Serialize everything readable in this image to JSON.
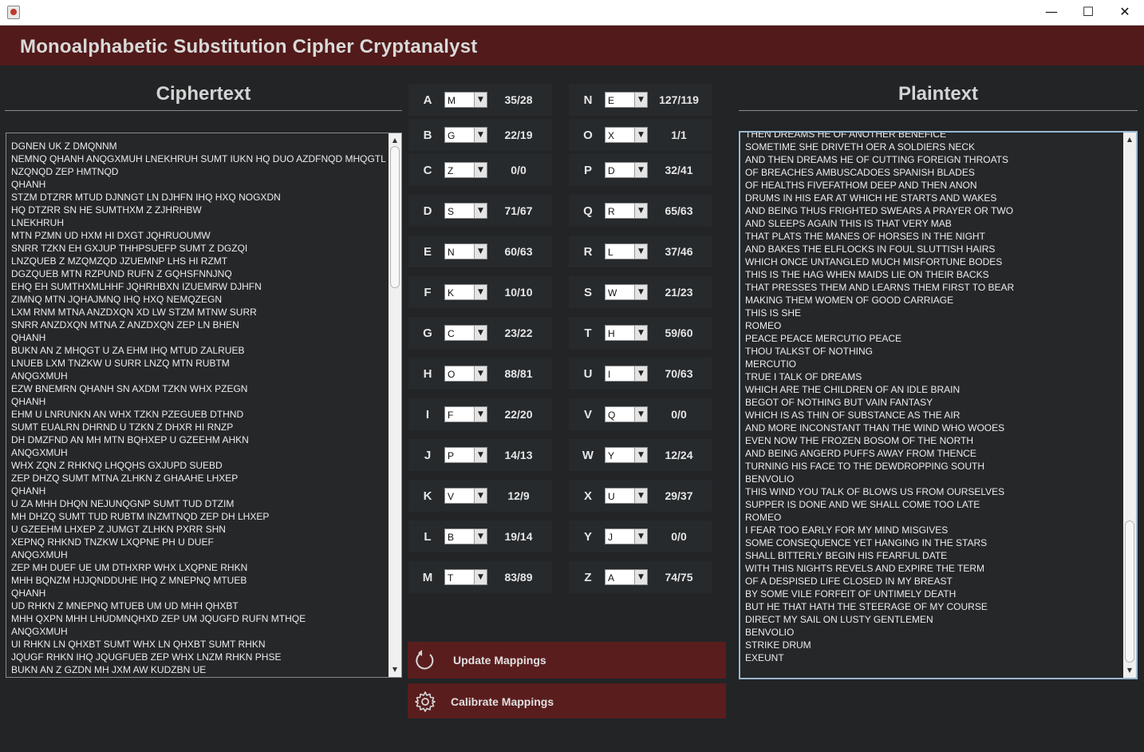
{
  "window": {
    "minimize_glyph": "—",
    "maximize_glyph": "☐",
    "close_glyph": "✕"
  },
  "header": {
    "title": "Monoalphabetic Substitution Cipher Cryptanalyst"
  },
  "ciphertext": {
    "title": "Ciphertext",
    "lines": [
      "DGNEN UK Z DMQNNM",
      "NEMNQ QHANH ANQGXMUH LNEKHRUH SUMT IUKN HQ DUO AZDFNQD MHQGTL",
      "NZQNQD ZEP HMTNQD",
      "QHANH",
      "STZM DTZRR MTUD DJNNGT LN DJHFN IHQ HXQ NOGXDN",
      "HQ DTZRR SN HE SUMTHXM Z ZJHRHBW",
      "LNEKHRUH",
      "MTN PZMN UD HXM HI DXGT JQHRUOUMW",
      "SNRR TZKN EH GXJUP THHPSUEFP SUMT Z DGZQI",
      "LNZQUEB Z MZQMZQD JZUEMNP LHS HI RZMT",
      "DGZQUEB MTN RZPUND RUFN Z GQHSFNNJNQ",
      "EHQ EH SUMTHXMLHHF JQHRHBXN IZUEMRW DJHFN",
      "ZIMNQ MTN JQHAJMNQ IHQ HXQ NEMQZEGN",
      "LXM RNM MTNA ANZDXQN XD LW STZM MTNW SURR",
      "SNRR ANZDXQN MTNA Z ANZDXQN ZEP LN BHEN",
      "QHANH",
      "BUKN AN Z MHQGT U ZA EHM IHQ MTUD ZALRUEB",
      "LNUEB LXM TNZKW U SURR LNZQ MTN RUBTM",
      "ANQGXMUH",
      "EZW BNEMRN QHANH SN AXDM TZKN WHX PZEGN",
      "QHANH",
      "EHM U LNRUNKN AN WHX TZKN PZEGUEB DTHND",
      "SUMT EUALRN DHRND U TZKN Z DHXR HI RNZP",
      "DH DMZFND AN MH MTN BQHXEP U GZEEHM AHKN",
      "ANQGXMUH",
      "WHX ZQN Z RHKNQ LHQQHS GXJUPD SUEBD",
      "ZEP DHZQ SUMT MTNA ZLHKN Z GHAAHE LHXEP",
      "QHANH",
      "U ZA MHH DHQN NEJUNQGNP SUMT TUD DTZIM",
      "MH DHZQ SUMT TUD RUBTM INZMTNQD ZEP DH LHXEP",
      "U GZEEHM LHXEP Z JUMGT ZLHKN PXRR SHN",
      "XEPNQ RHKND TNZKW LXQPNE PH U DUEF",
      "ANQGXMUH",
      "ZEP MH DUEF UE UM DTHXRP WHX LXQPNE RHKN",
      "MHH BQNZM HJJQNDDUHE IHQ Z MNEPNQ MTUEB",
      "QHANH",
      "UD RHKN Z MNEPNQ MTUEB UM UD MHH QHXBT",
      "MHH QXPN MHH LHUDMNQHXD ZEP UM JQUGFD RUFN MTHQE",
      "ANQGXMUH",
      "UI RHKN LN QHXBT SUMT WHX LN QHXBT SUMT RHKN",
      "JQUGF RHKN IHQ JQUGFUEB ZEP WHX LNZM RHKN PHSE",
      "BUKN AN Z GZDN MH JXM AW KUDZBN UE"
    ]
  },
  "plaintext": {
    "title": "Plaintext",
    "lines": [
      "THEN DREAMS HE OF ANOTHER BENEFICE",
      "SOMETIME SHE DRIVETH OER A SOLDIERS NECK",
      "AND THEN DREAMS HE OF CUTTING FOREIGN THROATS",
      "OF BREACHES AMBUSCADOES SPANISH BLADES",
      "OF HEALTHS FIVEFATHOM DEEP AND THEN ANON",
      "DRUMS IN HIS EAR AT WHICH HE STARTS AND WAKES",
      "AND BEING THUS FRIGHTED SWEARS A PRAYER OR TWO",
      "AND SLEEPS AGAIN THIS IS THAT VERY MAB",
      "THAT PLATS THE MANES OF HORSES IN THE NIGHT",
      "AND BAKES THE ELFLOCKS IN FOUL SLUTTISH HAIRS",
      "WHICH ONCE UNTANGLED MUCH MISFORTUNE BODES",
      "THIS IS THE HAG WHEN MAIDS LIE ON THEIR BACKS",
      "THAT PRESSES THEM AND LEARNS THEM FIRST TO BEAR",
      "MAKING THEM WOMEN OF GOOD CARRIAGE",
      "THIS IS SHE",
      "ROMEO",
      "PEACE PEACE MERCUTIO PEACE",
      "THOU TALKST OF NOTHING",
      "MERCUTIO",
      "TRUE I TALK OF DREAMS",
      "WHICH ARE THE CHILDREN OF AN IDLE BRAIN",
      "BEGOT OF NOTHING BUT VAIN FANTASY",
      "WHICH IS AS THIN OF SUBSTANCE AS THE AIR",
      "AND MORE INCONSTANT THAN THE WIND WHO WOOES",
      "EVEN NOW THE FROZEN BOSOM OF THE NORTH",
      "AND BEING ANGERD PUFFS AWAY FROM THENCE",
      "TURNING HIS FACE TO THE DEWDROPPING SOUTH",
      "BENVOLIO",
      "THIS WIND YOU TALK OF BLOWS US FROM OURSELVES",
      "SUPPER IS DONE AND WE SHALL COME TOO LATE",
      "ROMEO",
      "I FEAR TOO EARLY FOR MY MIND MISGIVES",
      "SOME CONSEQUENCE YET HANGING IN THE STARS",
      "SHALL BITTERLY BEGIN HIS FEARFUL DATE",
      "WITH THIS NIGHTS REVELS AND EXPIRE THE TERM",
      "OF A DESPISED LIFE CLOSED IN MY BREAST",
      "BY SOME VILE FORFEIT OF UNTIMELY DEATH",
      "BUT HE THAT HATH THE STEERAGE OF MY COURSE",
      "DIRECT MY SAIL ON LUSTY GENTLEMEN",
      "BENVOLIO",
      "STRIKE DRUM",
      "EXEUNT"
    ]
  },
  "mappings": {
    "left": [
      {
        "letter": "A",
        "value": "M",
        "count": "35/28"
      },
      {
        "letter": "B",
        "value": "G",
        "count": "22/19"
      },
      {
        "letter": "C",
        "value": "Z",
        "count": "0/0"
      },
      {
        "letter": "D",
        "value": "S",
        "count": "71/67"
      },
      {
        "letter": "E",
        "value": "N",
        "count": "60/63"
      },
      {
        "letter": "F",
        "value": "K",
        "count": "10/10"
      },
      {
        "letter": "G",
        "value": "C",
        "count": "23/22"
      },
      {
        "letter": "H",
        "value": "O",
        "count": "88/81"
      },
      {
        "letter": "I",
        "value": "F",
        "count": "22/20"
      },
      {
        "letter": "J",
        "value": "P",
        "count": "14/13"
      },
      {
        "letter": "K",
        "value": "V",
        "count": "12/9"
      },
      {
        "letter": "L",
        "value": "B",
        "count": "19/14"
      },
      {
        "letter": "M",
        "value": "T",
        "count": "83/89"
      }
    ],
    "right": [
      {
        "letter": "N",
        "value": "E",
        "count": "127/119"
      },
      {
        "letter": "O",
        "value": "X",
        "count": "1/1"
      },
      {
        "letter": "P",
        "value": "D",
        "count": "32/41"
      },
      {
        "letter": "Q",
        "value": "R",
        "count": "65/63"
      },
      {
        "letter": "R",
        "value": "L",
        "count": "37/46"
      },
      {
        "letter": "S",
        "value": "W",
        "count": "21/23"
      },
      {
        "letter": "T",
        "value": "H",
        "count": "59/60"
      },
      {
        "letter": "U",
        "value": "I",
        "count": "70/63"
      },
      {
        "letter": "V",
        "value": "Q",
        "count": "0/0"
      },
      {
        "letter": "W",
        "value": "Y",
        "count": "12/24"
      },
      {
        "letter": "X",
        "value": "U",
        "count": "29/37"
      },
      {
        "letter": "Y",
        "value": "J",
        "count": "0/0"
      },
      {
        "letter": "Z",
        "value": "A",
        "count": "74/75"
      }
    ]
  },
  "actions": {
    "update_label": "Update Mappings",
    "calibrate_label": "Calibrate Mappings"
  },
  "colors": {
    "header_bg": "#521a1a",
    "button_bg": "#5a1d1d",
    "window_bg": "#222426"
  }
}
